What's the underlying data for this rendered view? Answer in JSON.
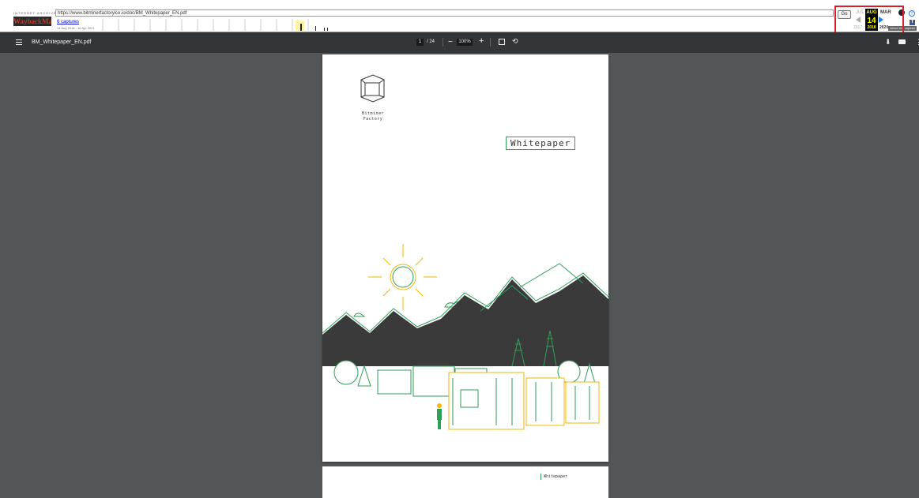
{
  "wayback": {
    "logo_top": "INTERNET ARCHIVE",
    "logo": "WaybackMachine",
    "url": "https://www.bitminerfactoryico.io/doc/BM_Whitepaper_EN.pdf",
    "captures": "6 captures",
    "range": "14 Aug 2018 - 16 Apr 2021",
    "go": "Go",
    "months": {
      "prev": "JUL",
      "current": "AUG",
      "next": "MAR"
    },
    "day": "14",
    "years": {
      "prev": "2017",
      "current": "2018",
      "next": "2020"
    },
    "about": "About this capture"
  },
  "pdf": {
    "title": "BM_Whitepaper_EN.pdf",
    "current_page": "1",
    "page_total": "/ 24",
    "zoom": "100%",
    "zoom_out": "−",
    "zoom_in": "+"
  },
  "page1": {
    "brand_line1": "Bitminer",
    "brand_line2": "Factory",
    "title": "Whitepaper"
  },
  "page2": {
    "label": "Whitepaper"
  }
}
